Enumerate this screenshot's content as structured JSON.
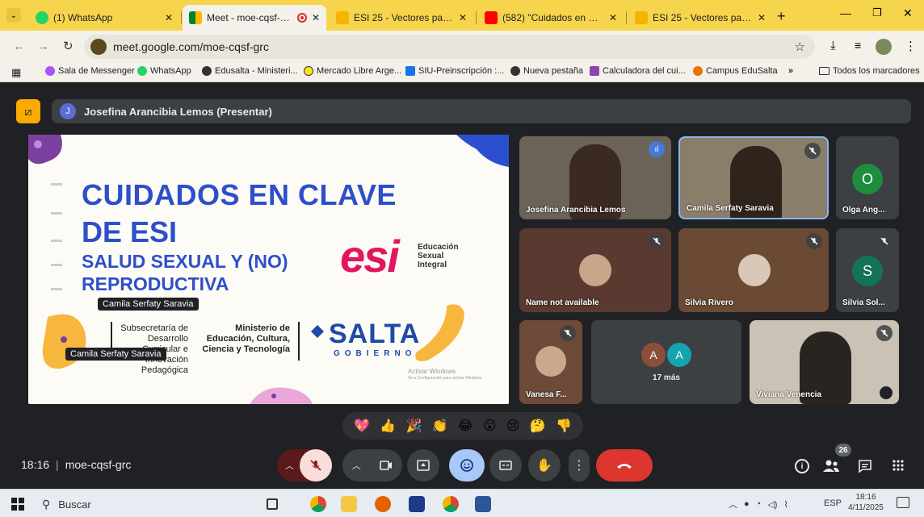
{
  "browser": {
    "tabs": [
      {
        "title": "(1) WhatsApp",
        "icon": "whatsapp-icon",
        "active": false
      },
      {
        "title": "Meet - moe-cqsf-grc",
        "icon": "meet-icon",
        "active": true
      },
      {
        "title": "ESI 25 - Vectores para Rosar",
        "icon": "slides-icon",
        "active": false
      },
      {
        "title": "(582) \"Cuidados en Clave de",
        "icon": "youtube-icon",
        "active": false
      },
      {
        "title": "ESI 25 - Vectores para Rosar",
        "icon": "slides-icon",
        "active": false
      }
    ],
    "url": "meet.google.com/moe-cqsf-grc",
    "bookmarks": [
      "Sala de Messenger",
      "WhatsApp",
      "Edusalta - Ministeri...",
      "Mercado Libre Arge...",
      "SIU-Preinscripción :...",
      "Nueva pestaña",
      "Calculadora del cui...",
      "Campus EduSalta"
    ],
    "bookmarks_overflow": "»",
    "all_bookmarks": "Todos los marcadores"
  },
  "meet": {
    "presenter_initial": "J",
    "presenter_label": "Josefina Arancibia Lemos (Presentar)",
    "slide": {
      "title_line1": "CUIDADOS EN CLAVE",
      "title_line2": "DE ESI",
      "subtitle_line1": "SALUD SEXUAL Y (NO)",
      "subtitle_line2": "REPRODUCTIVA",
      "esi_logo": "esi",
      "esi_text1": "Educación",
      "esi_text2": "Sexual",
      "esi_text3": "Integral",
      "sub1": "Subsecretaría de",
      "sub2": "Desarrollo Curricular e",
      "sub3": "Innovación Pedagógica",
      "min1": "Ministerio de",
      "min2": "Educación, Cultura,",
      "min3": "Ciencia y Tecnología",
      "salta": "SALTA",
      "gobierno": "GOBIERNO",
      "activate1": "Activar Windows",
      "activate2": "Ve a Configuración para activar Windows.",
      "name_tag1": "Camila Serfaty Saravia",
      "name_tag2": "Camila Serfaty Saravia"
    },
    "participants": [
      {
        "name": "Josefina Arancibia Lemos",
        "initial": "",
        "bg": "#6b6357"
      },
      {
        "name": "Camila Serfaty Saravia",
        "initial": "",
        "bg": "#8a7d6a"
      },
      {
        "name": "Olga Ang...",
        "initial": "O",
        "bg": "#1e8e3e"
      },
      {
        "name": "Name not available",
        "initial": "",
        "bg": "#5a3a30"
      },
      {
        "name": "Silvia Rivero",
        "initial": "",
        "bg": "#6a4a34"
      },
      {
        "name": "Silvia Sol...",
        "initial": "S",
        "bg": "#137356"
      },
      {
        "name": "Vanesa F...",
        "initial": "",
        "bg": "#6e4a3a"
      },
      {
        "name": "Viviana Venencia",
        "initial": "",
        "bg": "#c9c2b5"
      }
    ],
    "more_count": "17 más",
    "more_initials": [
      "A",
      "A"
    ],
    "reactions": [
      "💖",
      "👍",
      "🎉",
      "👏",
      "😂",
      "😮",
      "😢",
      "🤔",
      "👎"
    ],
    "time": "18:16",
    "meeting_code": "moe-cqsf-grc",
    "participant_count": "26"
  },
  "taskbar": {
    "search_placeholder": "Buscar",
    "lang": "ESP",
    "time": "18:16",
    "date": "4/11/2025"
  }
}
